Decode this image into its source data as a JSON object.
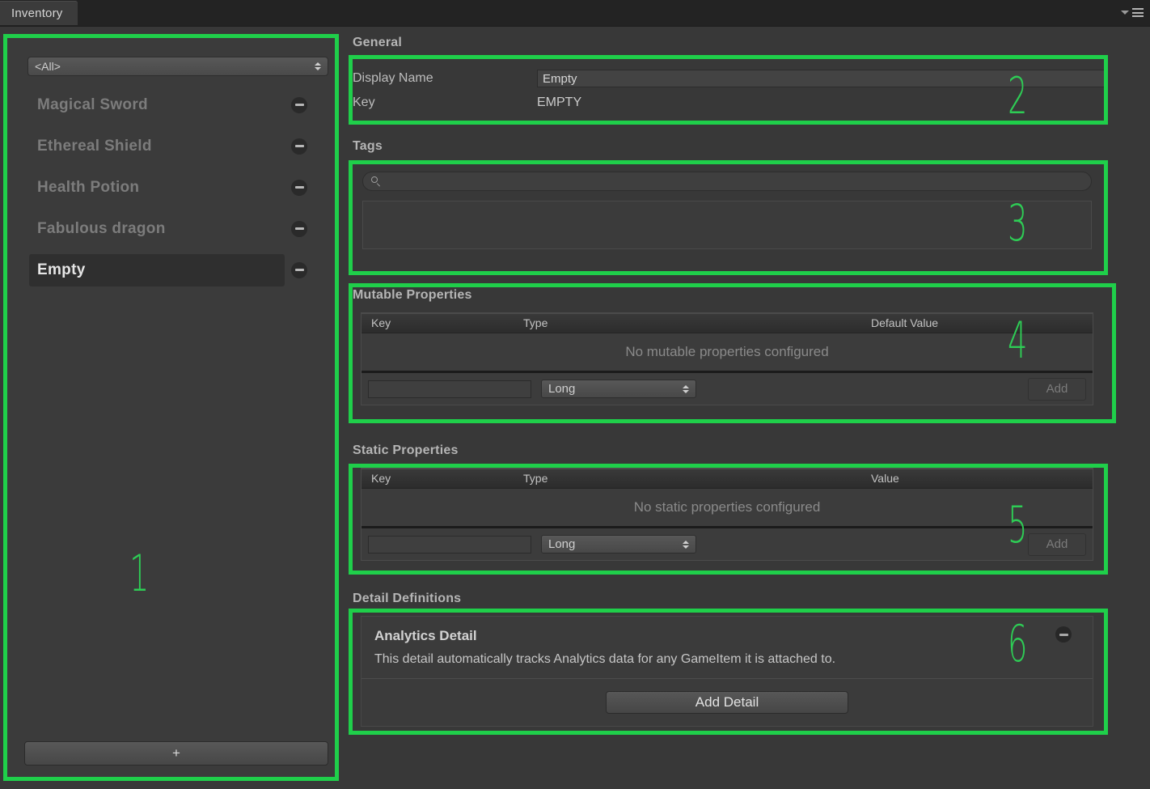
{
  "window": {
    "tab_label": "Inventory",
    "menu_caret_icon": "chevron-down-icon",
    "menu_icon": "hamburger-menu-icon"
  },
  "sidebar": {
    "filter": {
      "selected": "<All>",
      "icon": "select-arrows-icon"
    },
    "items": [
      {
        "label": "Magical Sword",
        "selected": false,
        "remove_icon": "minus-circle-icon"
      },
      {
        "label": "Ethereal Shield",
        "selected": false,
        "remove_icon": "minus-circle-icon"
      },
      {
        "label": "Health Potion",
        "selected": false,
        "remove_icon": "minus-circle-icon"
      },
      {
        "label": "Fabulous dragon",
        "selected": false,
        "remove_icon": "minus-circle-icon"
      },
      {
        "label": "Empty",
        "selected": true,
        "remove_icon": "minus-circle-icon"
      }
    ],
    "add_button_label": "+"
  },
  "general": {
    "title": "General",
    "display_name_label": "Display Name",
    "display_name_value": "Empty",
    "key_label": "Key",
    "key_value": "EMPTY"
  },
  "tags": {
    "title": "Tags",
    "search_placeholder": "",
    "search_value": "",
    "search_icon": "search-icon",
    "list_items": []
  },
  "mutable_properties": {
    "title": "Mutable Properties",
    "columns": [
      "Key",
      "Type",
      "Default Value"
    ],
    "rows": [],
    "empty_message": "No mutable properties configured",
    "new_key_value": "",
    "new_key_placeholder": "",
    "type_selected": "Long",
    "add_label": "Add"
  },
  "static_properties": {
    "title": "Static Properties",
    "columns": [
      "Key",
      "Type",
      "Value"
    ],
    "rows": [],
    "empty_message": "No static properties configured",
    "new_key_value": "",
    "new_key_placeholder": "",
    "type_selected": "Long",
    "add_label": "Add"
  },
  "detail_definitions": {
    "title": "Detail Definitions",
    "details": [
      {
        "name": "Analytics Detail",
        "description": "This detail automatically tracks Analytics data for any GameItem it is attached to.",
        "remove_icon": "minus-circle-icon"
      }
    ],
    "add_detail_label": "Add Detail"
  },
  "annotations": {
    "accent_color": "#1fcf4a",
    "markers": [
      {
        "number": "1",
        "target": "sidebar"
      },
      {
        "number": "2",
        "target": "general"
      },
      {
        "number": "3",
        "target": "tags"
      },
      {
        "number": "4",
        "target": "mutable-properties"
      },
      {
        "number": "5",
        "target": "static-properties"
      },
      {
        "number": "6",
        "target": "detail-definitions"
      }
    ]
  }
}
